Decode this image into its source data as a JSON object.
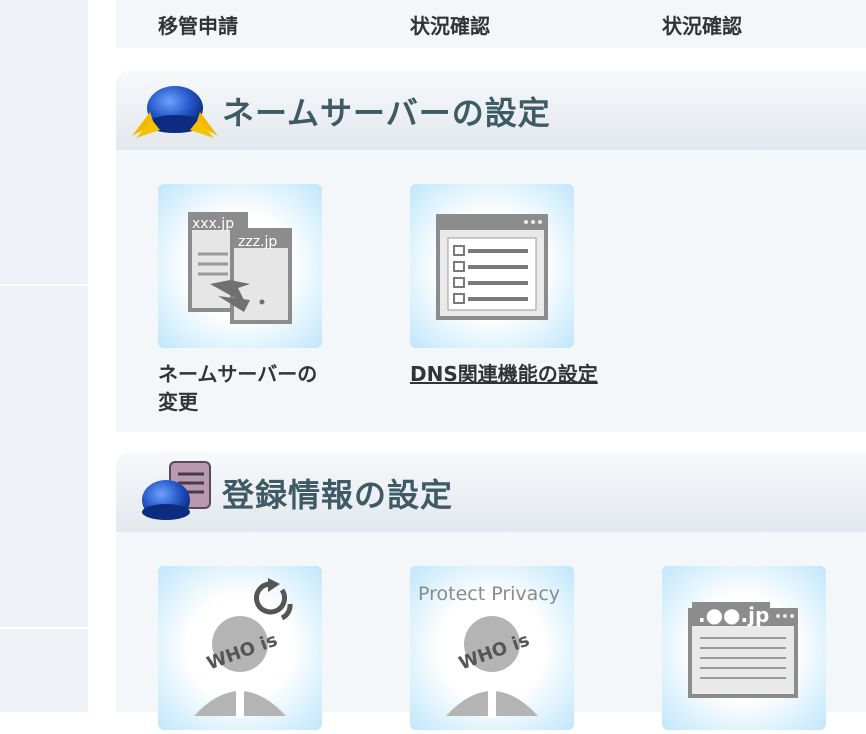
{
  "top_row": {
    "items": [
      {
        "label": "移管申請"
      },
      {
        "label": "状況確認"
      },
      {
        "label": "状況確認"
      }
    ]
  },
  "nameserver_section": {
    "title": "ネームサーバーの設定",
    "tiles": [
      {
        "label_line1": "ネームサーバーの",
        "label_line2": "変更",
        "icon_text_1": "xxx.jp",
        "icon_text_2": "zzz.jp"
      },
      {
        "label": "DNS関連機能の設定"
      }
    ]
  },
  "registration_section": {
    "title": "登録情報の設定",
    "tiles": [
      {
        "icon_text": "WHO is"
      },
      {
        "icon_caption": "Protect Privacy",
        "icon_text": "WHO is"
      },
      {
        "icon_text": ".●●.jp"
      }
    ]
  },
  "colors": {
    "accent": "#3e5a64",
    "tile_glow": "#bfe6fb",
    "panel_bg": "#f3f7fa"
  }
}
